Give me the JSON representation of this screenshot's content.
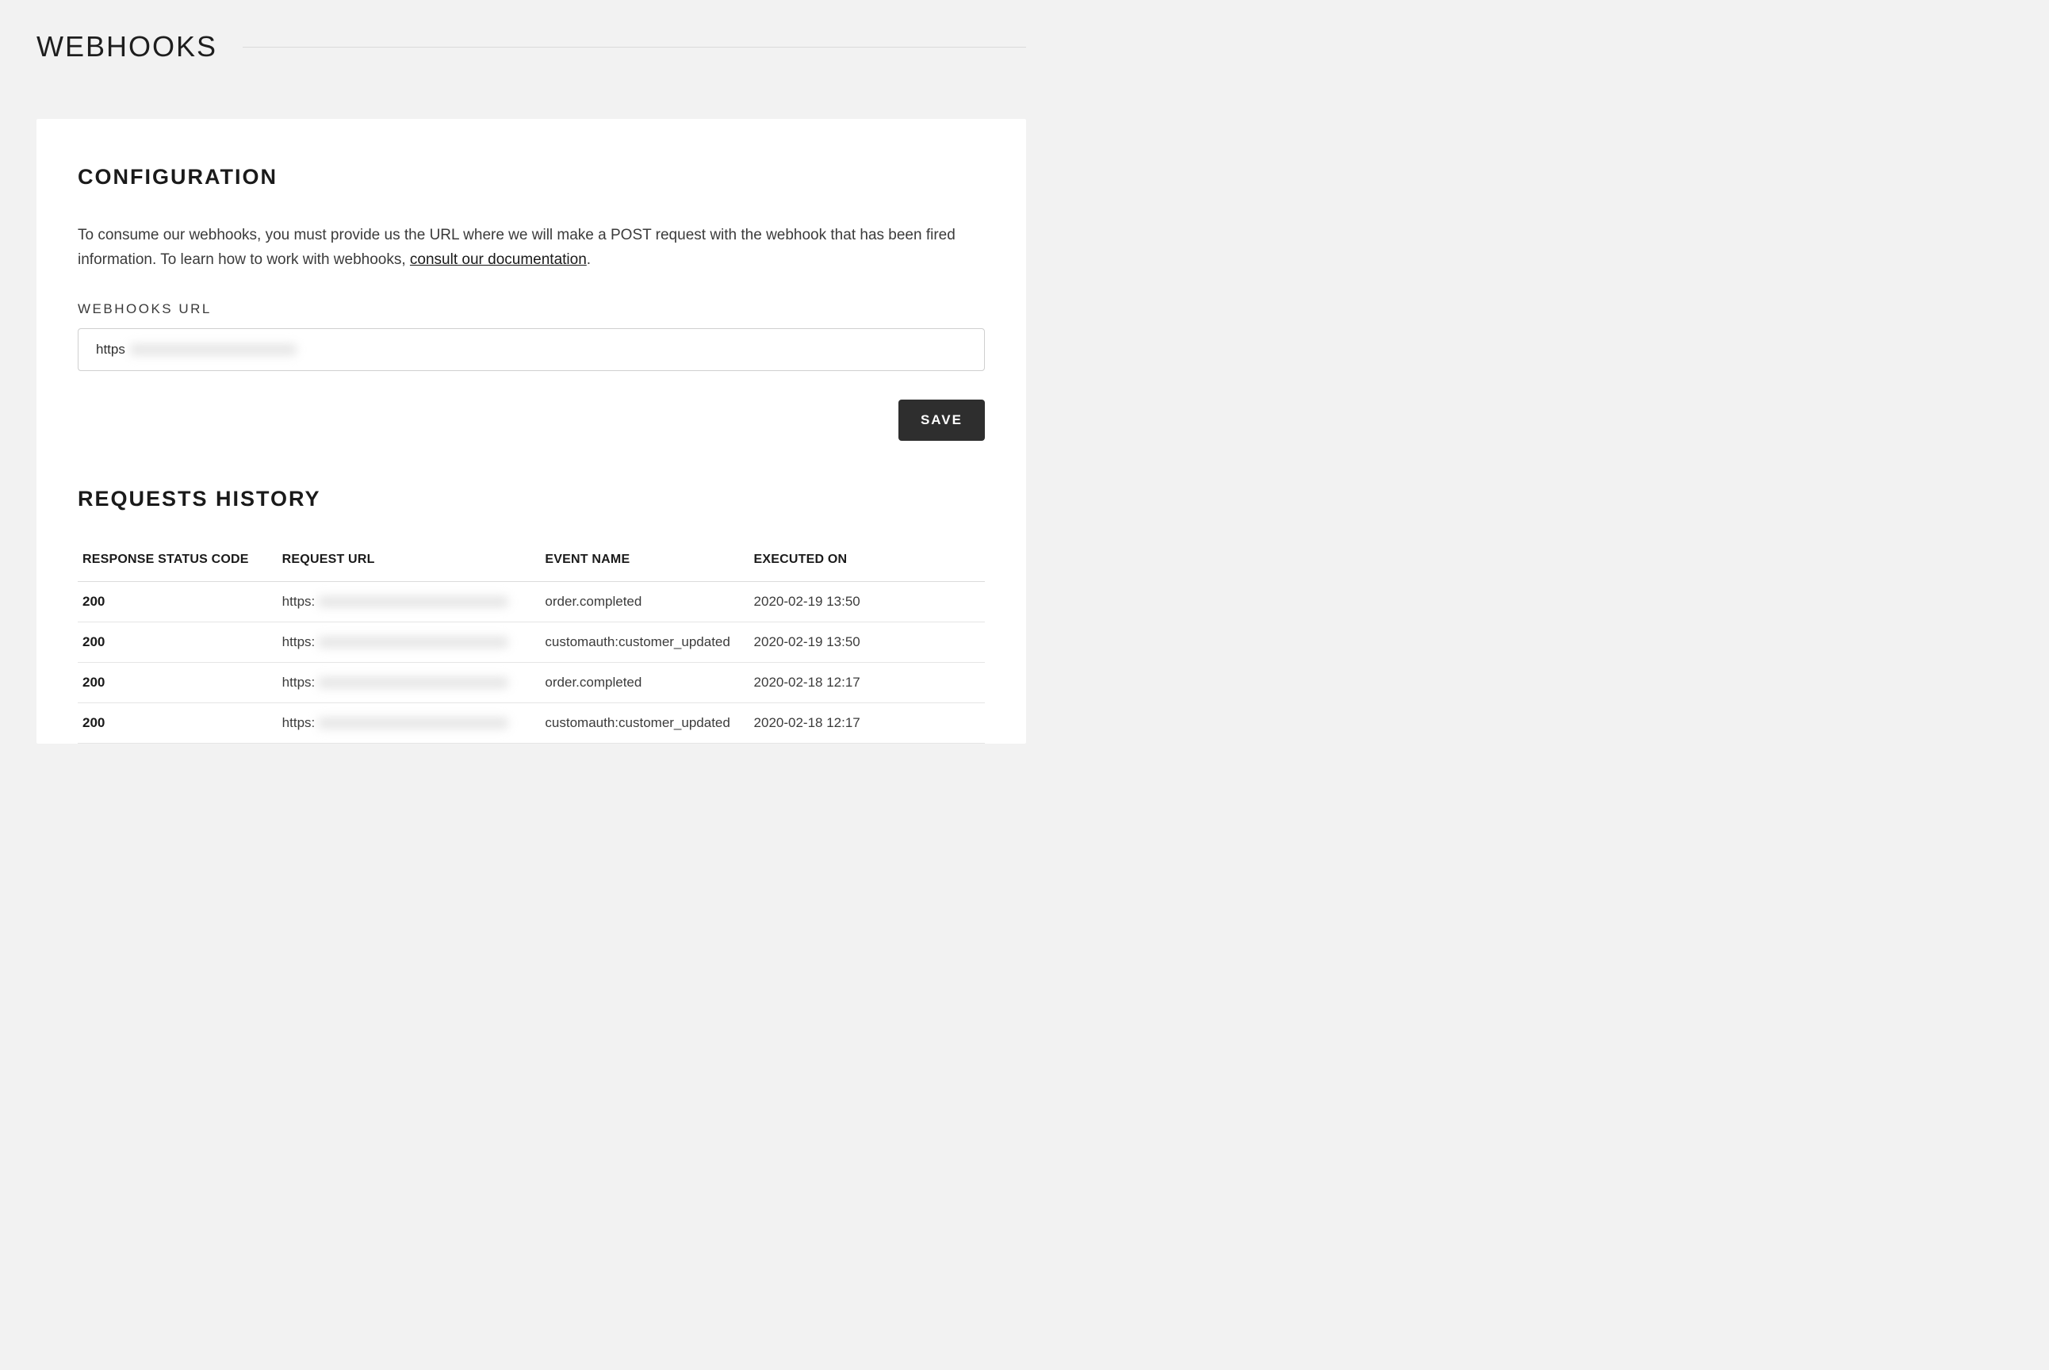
{
  "page": {
    "title": "WEBHOOKS"
  },
  "configuration": {
    "title": "CONFIGURATION",
    "description_pre": "To consume our webhooks, you must provide us the URL where we will make a POST request with the webhook that has been fired information. To learn how to work with webhooks, ",
    "doc_link_text": "consult our documentation",
    "description_post": ".",
    "url_label": "WEBHOOKS URL",
    "url_prefix": "https",
    "save_label": "SAVE"
  },
  "history": {
    "title": "REQUESTS HISTORY",
    "columns": {
      "status": "RESPONSE STATUS CODE",
      "url": "REQUEST URL",
      "event": "EVENT NAME",
      "executed": "EXECUTED ON"
    },
    "rows": [
      {
        "status": "200",
        "url_prefix": "https:",
        "event": "order.completed",
        "executed": "2020-02-19 13:50"
      },
      {
        "status": "200",
        "url_prefix": "https:",
        "event": "customauth:customer_updated",
        "executed": "2020-02-19 13:50"
      },
      {
        "status": "200",
        "url_prefix": "https:",
        "event": "order.completed",
        "executed": "2020-02-18 12:17"
      },
      {
        "status": "200",
        "url_prefix": "https:",
        "event": "customauth:customer_updated",
        "executed": "2020-02-18 12:17"
      }
    ]
  }
}
